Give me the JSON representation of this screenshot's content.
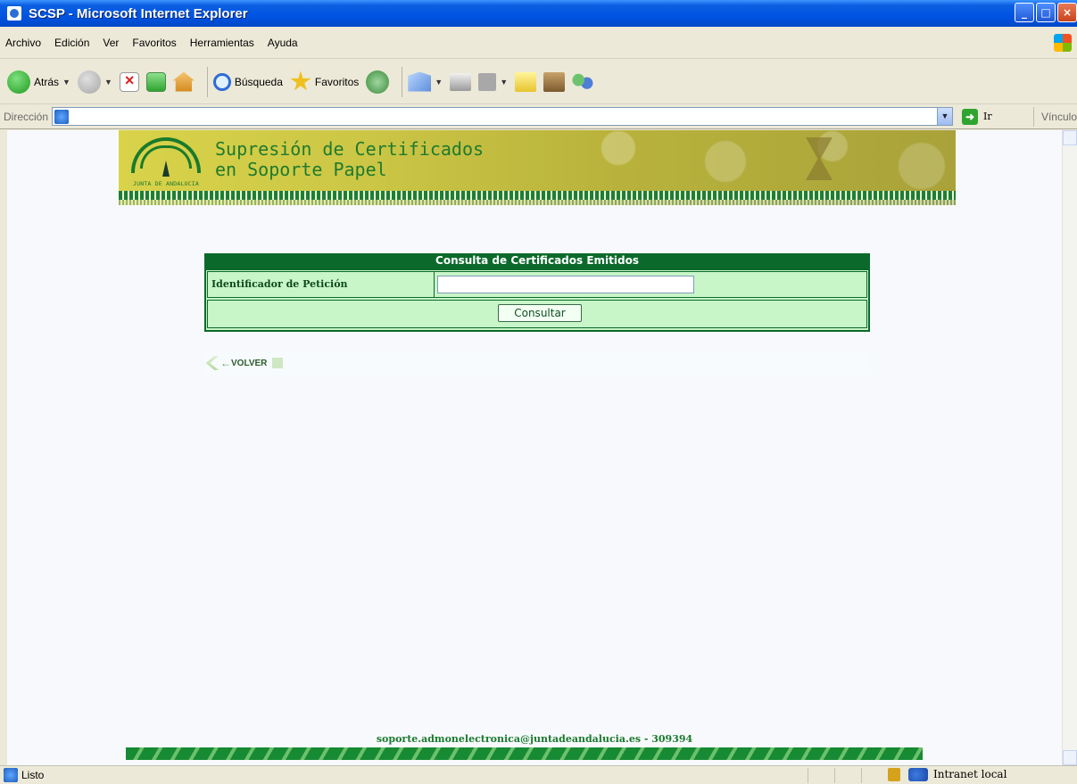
{
  "window": {
    "title": "SCSP - Microsoft Internet Explorer"
  },
  "menu": {
    "items": [
      "Archivo",
      "Edición",
      "Ver",
      "Favoritos",
      "Herramientas",
      "Ayuda"
    ]
  },
  "toolbar": {
    "back_label": "Atrás",
    "search_label": "Búsqueda",
    "favorites_label": "Favoritos"
  },
  "address": {
    "label": "Dirección",
    "go_label": "Ir",
    "links_label": "Vínculo"
  },
  "banner": {
    "title_line1": "Supresión de Certificados",
    "title_line2": "en Soporte Papel",
    "logo_text": "JUNTA DE ANDALUCIA"
  },
  "form": {
    "header": "Consulta de Certificados Emitidos",
    "field_label": "Identificador de Petición",
    "field_value": "",
    "submit_label": "Consultar"
  },
  "nav": {
    "back_link": "VOLVER"
  },
  "footer": {
    "contact": "soporte.admonelectronica@juntadeandalucia.es - 309394"
  },
  "status": {
    "text": "Listo",
    "zone": "Intranet local"
  },
  "colors": {
    "primary_green": "#0b6a2b",
    "panel_bg": "#c8f6c8",
    "banner_yellow": "#cbc645"
  }
}
